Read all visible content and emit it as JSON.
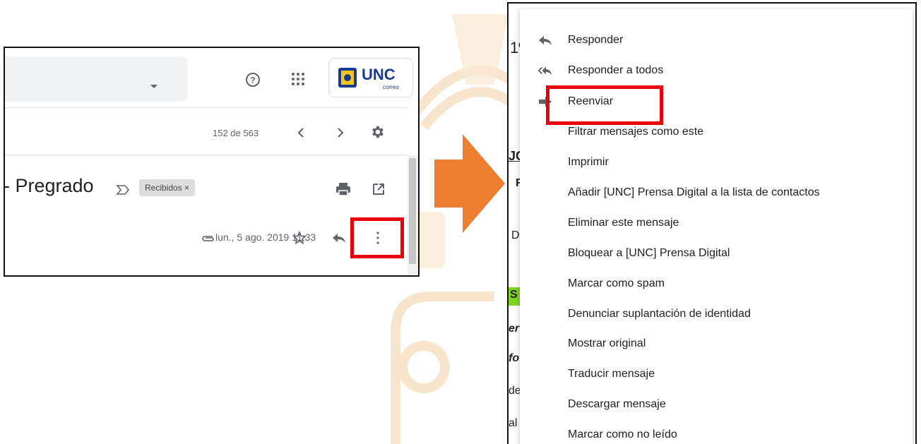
{
  "left_panel": {
    "pagination": {
      "count_text": "152 de 563"
    },
    "logo": {
      "name": "UNC",
      "subtitle": "correo"
    },
    "email": {
      "subject_fragment": "- Pregrado",
      "label_chip": "Recibidos ×",
      "date": "lun., 5 ago. 2019 11:33"
    }
  },
  "right_panel": {
    "background_fragments": [
      "1º",
      "JC",
      "R",
      "D",
      "S",
      "er",
      "fo",
      "de",
      "al"
    ],
    "menu_items": [
      {
        "label": "Responder",
        "icon": "reply-icon"
      },
      {
        "label": "Responder a todos",
        "icon": "reply-all-icon"
      },
      {
        "label": "Reenviar",
        "icon": "forward-icon"
      },
      {
        "label": "Filtrar mensajes como este"
      },
      {
        "label": "Imprimir"
      },
      {
        "label": "Añadir [UNC] Prensa Digital a la lista de contactos"
      },
      {
        "label": "Eliminar este mensaje"
      },
      {
        "label": "Bloquear a [UNC] Prensa Digital"
      },
      {
        "label": "Marcar como spam"
      },
      {
        "label": "Denunciar suplantación de identidad"
      },
      {
        "label": "Mostrar original"
      },
      {
        "label": "Traducir mensaje"
      },
      {
        "label": "Descargar mensaje"
      },
      {
        "label": "Marcar como no leído"
      }
    ]
  },
  "colors": {
    "highlight_red": "#e8000b",
    "arrow_orange": "#ed7d31",
    "watermark": "#f8e3c4",
    "unc_blue": "#1a3a8f"
  }
}
